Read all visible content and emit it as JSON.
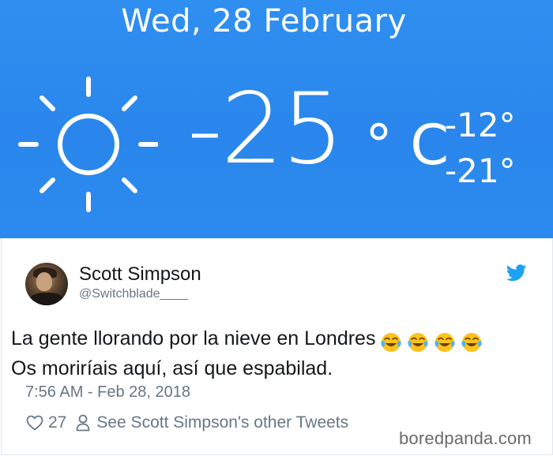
{
  "weather": {
    "date": "Wed, 28 February",
    "temperature": "-25",
    "unit": "° C",
    "high": "-12°",
    "low": "-21°",
    "icon": "sun-icon",
    "background_color": "#2a86ec"
  },
  "tweet": {
    "author_name": "Scott Simpson",
    "handle": "@Switchblade____",
    "text_line1": "La gente llorando por la nieve en Londres",
    "text_line2": "Os moriríais aquí, así que espabilad.",
    "emoji": [
      "face-with-tears-of-joy",
      "face-with-tears-of-joy",
      "face-with-tears-of-joy",
      "face-with-tears-of-joy"
    ],
    "timestamp": "7:56 AM - Feb 28, 2018",
    "likes": "27",
    "other_tweets_link": "See Scott Simpson's other Tweets",
    "brand_icon": "twitter-bird-icon",
    "accent_color": "#1da1f2",
    "muted_color": "#657786"
  },
  "watermark": "boredpanda.com"
}
